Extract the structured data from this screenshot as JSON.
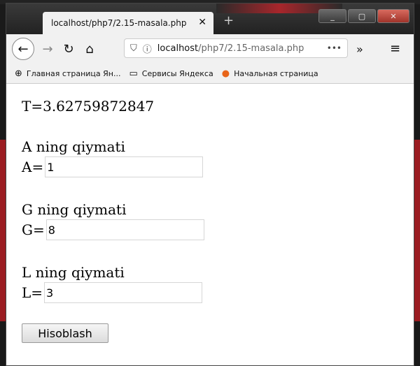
{
  "browser": {
    "tab_title": "localhost/php7/2.15-masala.php",
    "tab_close": "✕",
    "new_tab": "+",
    "url_host": "localhost",
    "url_path": "/php7/2.15-masala.php",
    "url_more": "•••",
    "overflow": "»",
    "menu": "≡",
    "bookmarks": [
      {
        "icon": "globe-icon",
        "label": "Главная страница Ян..."
      },
      {
        "icon": "folder-icon",
        "label": "Сервисы Яндекса"
      },
      {
        "icon": "firefox-icon",
        "label": "Начальная страница"
      }
    ]
  },
  "page": {
    "result": "T=3.62759872847",
    "fields": [
      {
        "heading": "A ning qiymati",
        "label": "A=",
        "value": "1"
      },
      {
        "heading": "G ning qiymati",
        "label": "G=",
        "value": "8"
      },
      {
        "heading": "L ning qiymati",
        "label": "L=",
        "value": "3"
      }
    ],
    "submit_label": "Hisoblash"
  }
}
